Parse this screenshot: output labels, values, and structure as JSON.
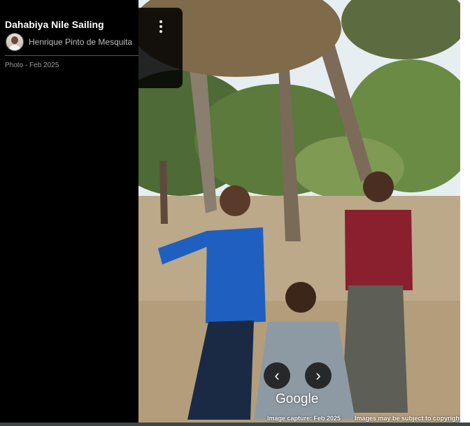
{
  "panel": {
    "title": "Dahabiya Nile Sailing",
    "author": "Henrique Pinto de Mesquita",
    "meta": "Photo - Feb 2025"
  },
  "photo": {
    "attribution": "Google",
    "capture_date": "Image capture: Feb 2025",
    "copyright": "Images may be subject to copyright.",
    "prev_icon": "chevron-left-icon",
    "next_icon": "chevron-right-icon"
  }
}
